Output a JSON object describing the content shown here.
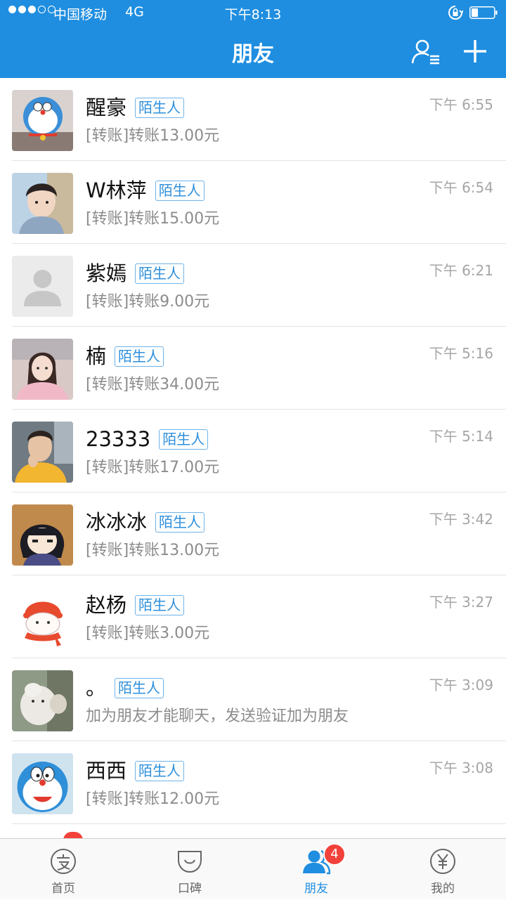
{
  "status_bar": {
    "carrier": "中国移动",
    "network": "4G",
    "time": "下午8:13",
    "signal_dots_filled": 3,
    "signal_dots_total": 5
  },
  "header": {
    "title": "朋友",
    "background": "#1f8ee0"
  },
  "friends": [
    {
      "name": "醒豪",
      "tag": "陌生人",
      "time": "下午 6:55",
      "preview": "[转账]转账13.00元",
      "avatar": "doraemon-plush-photo"
    },
    {
      "name": "W林萍",
      "tag": "陌生人",
      "time": "下午 6:54",
      "preview": "[转账]转账15.00元",
      "avatar": "boy-photo"
    },
    {
      "name": "紫嫣",
      "tag": "陌生人",
      "time": "下午 6:21",
      "preview": "[转账]转账9.00元",
      "avatar": "default-user-icon"
    },
    {
      "name": "楠",
      "tag": "陌生人",
      "time": "下午 5:16",
      "preview": "[转账]转账34.00元",
      "avatar": "girl-photo"
    },
    {
      "name": "23333",
      "tag": "陌生人",
      "time": "下午 5:14",
      "preview": "[转账]转账17.00元",
      "avatar": "man-in-yellow-photo"
    },
    {
      "name": "冰冰冰",
      "tag": "陌生人",
      "time": "下午 3:42",
      "preview": "[转账]转账13.00元",
      "avatar": "anime-character"
    },
    {
      "name": "赵杨",
      "tag": "陌生人",
      "time": "下午 3:27",
      "preview": "[转账]转账3.00元",
      "avatar": "cartoon-in-red-hat"
    },
    {
      "name": "。",
      "tag": "陌生人",
      "time": "下午 3:09",
      "preview": "加为朋友才能聊天，发送验证加为朋友",
      "avatar": "white-dog-photo"
    },
    {
      "name": "西西",
      "tag": "陌生人",
      "time": "下午 3:08",
      "preview": "[转账]转账12.00元",
      "avatar": "doraemon-face"
    }
  ],
  "tabbar": {
    "tabs": [
      {
        "label": "首页",
        "icon": "alipay-icon"
      },
      {
        "label": "口碑",
        "icon": "koubei-icon"
      },
      {
        "label": "朋友",
        "icon": "friends-icon",
        "active": true
      },
      {
        "label": "我的",
        "icon": "yuan-icon"
      }
    ],
    "friends_badge": "4"
  },
  "colors": {
    "accent": "#1f8ee0",
    "tag_text": "#2d8fdb",
    "badge": "#f2413a"
  }
}
